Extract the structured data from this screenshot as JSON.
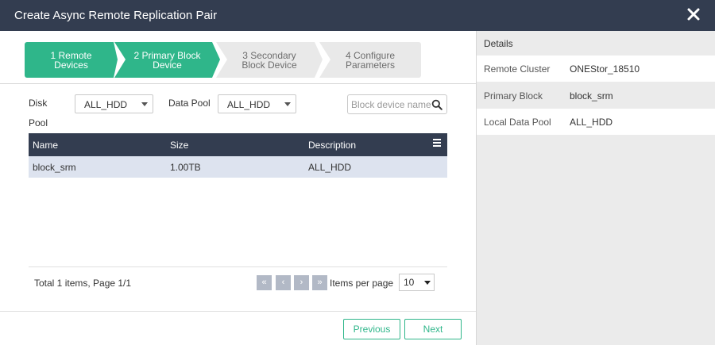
{
  "dialog": {
    "title": "Create Async Remote Replication Pair"
  },
  "wizard": {
    "steps": [
      {
        "label": "1 Remote\nDevices",
        "state": "done"
      },
      {
        "label": "2 Primary Block\nDevice",
        "state": "current"
      },
      {
        "label": "3 Secondary\nBlock Device",
        "state": "todo"
      },
      {
        "label": "4 Configure\nParameters",
        "state": "todo"
      }
    ]
  },
  "filters": {
    "disk_pool_label_1": "Disk",
    "disk_pool_label_2": "Pool",
    "disk_pool_value": "ALL_HDD",
    "data_pool_label": "Data Pool",
    "data_pool_value": "ALL_HDD",
    "search_placeholder": "Block device name"
  },
  "table": {
    "columns": [
      "Name",
      "Size",
      "Description"
    ],
    "rows": [
      {
        "name": "block_srm",
        "size": "1.00TB",
        "description": "ALL_HDD"
      }
    ]
  },
  "pagination": {
    "total_text": "Total 1 items, Page 1/1",
    "first_icon": "«",
    "prev_icon": "‹",
    "next_icon": "›",
    "last_icon": "»",
    "items_per_page_label": "Items per page",
    "items_per_page_value": "10"
  },
  "footer": {
    "previous_label": "Previous",
    "next_label": "Next"
  },
  "details": {
    "title": "Details",
    "rows": [
      {
        "key": "Remote Cluster",
        "value": "ONEStor_18510"
      },
      {
        "key": "Primary Block",
        "value": "block_srm"
      },
      {
        "key": "Local Data Pool",
        "value": "ALL_HDD"
      }
    ]
  },
  "colors": {
    "header": "#333d50",
    "accent": "#2fb68a",
    "row_selected": "#dde3ef",
    "pager_button": "#b2b9c6"
  },
  "icons": {
    "close": "close-icon",
    "search": "search-icon",
    "column_menu": "menu-icon"
  }
}
